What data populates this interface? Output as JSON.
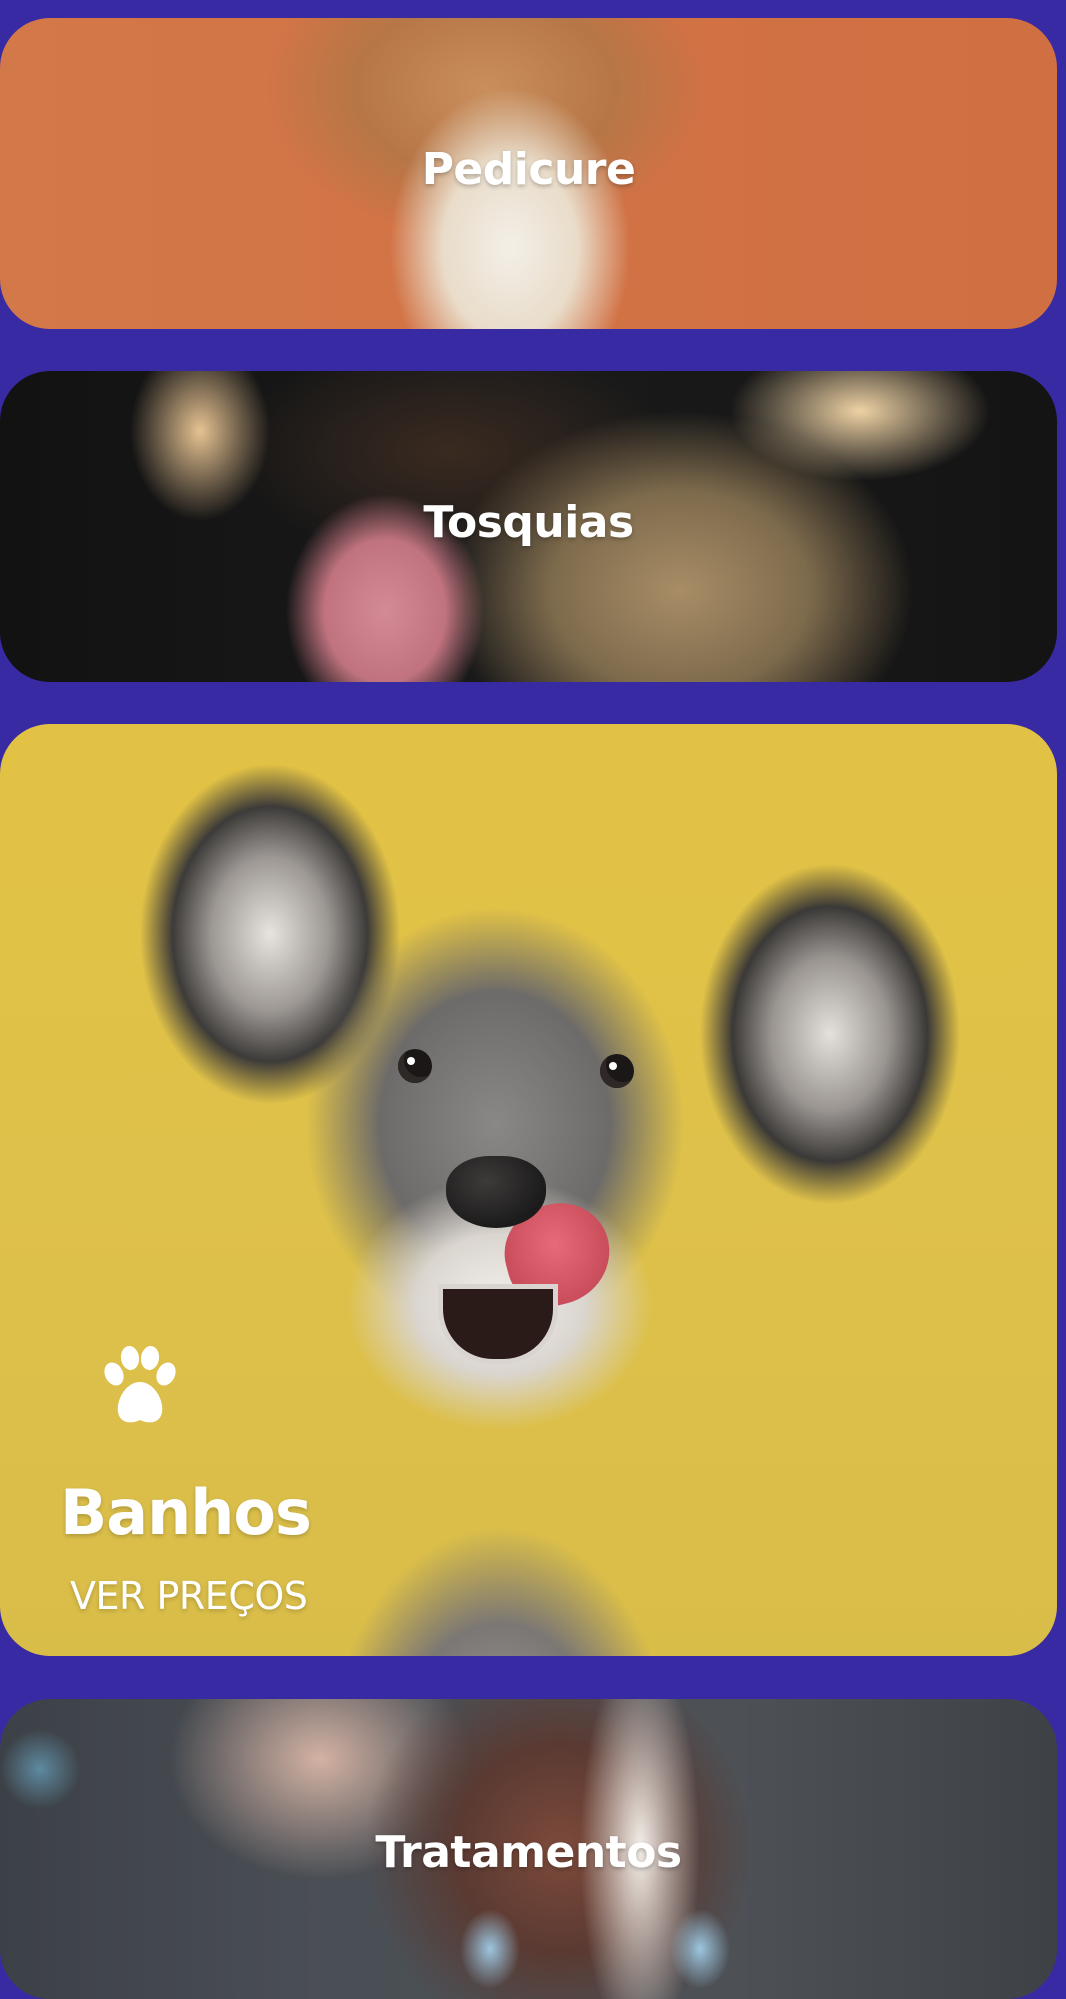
{
  "services": {
    "pedicure": {
      "title": "Pedicure"
    },
    "tosquias": {
      "title": "Tosquias"
    },
    "banhos": {
      "title": "Banhos",
      "link_label": "VER PREÇOS",
      "icon": "paw-icon"
    },
    "tratamentos": {
      "title": "Tratamentos"
    }
  },
  "colors": {
    "page_background": "#382aa3",
    "text": "#ffffff"
  }
}
